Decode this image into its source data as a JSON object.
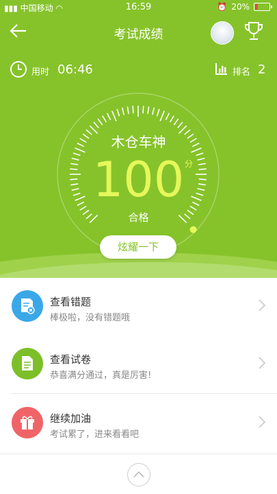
{
  "status_bar": {
    "carrier": "中国移动",
    "time": "16:59",
    "battery": "20%"
  },
  "header": {
    "title": "考试成绩"
  },
  "stats": {
    "time_label": "用时",
    "time_value": "06:46",
    "rank_label": "排名",
    "rank_value": "2"
  },
  "result": {
    "name": "木仓车神",
    "score": "100",
    "unit": "分",
    "verdict": "合格",
    "gauge_fraction": 1.0
  },
  "share_button": {
    "label": "炫耀一下"
  },
  "menu": [
    {
      "title": "查看错题",
      "subtitle": "棒极啦，没有错题哦",
      "icon": "wrong-questions-icon",
      "color": "#3aa8e8"
    },
    {
      "title": "查看试卷",
      "subtitle": "恭喜满分通过，真是厉害!",
      "icon": "paper-icon",
      "color": "#7dbf29"
    },
    {
      "title": "继续加油",
      "subtitle": "考试累了，进来看看吧",
      "icon": "gift-icon",
      "color": "#f06468"
    }
  ],
  "colors": {
    "primary": "#86c32a",
    "score": "#e6f75a"
  }
}
